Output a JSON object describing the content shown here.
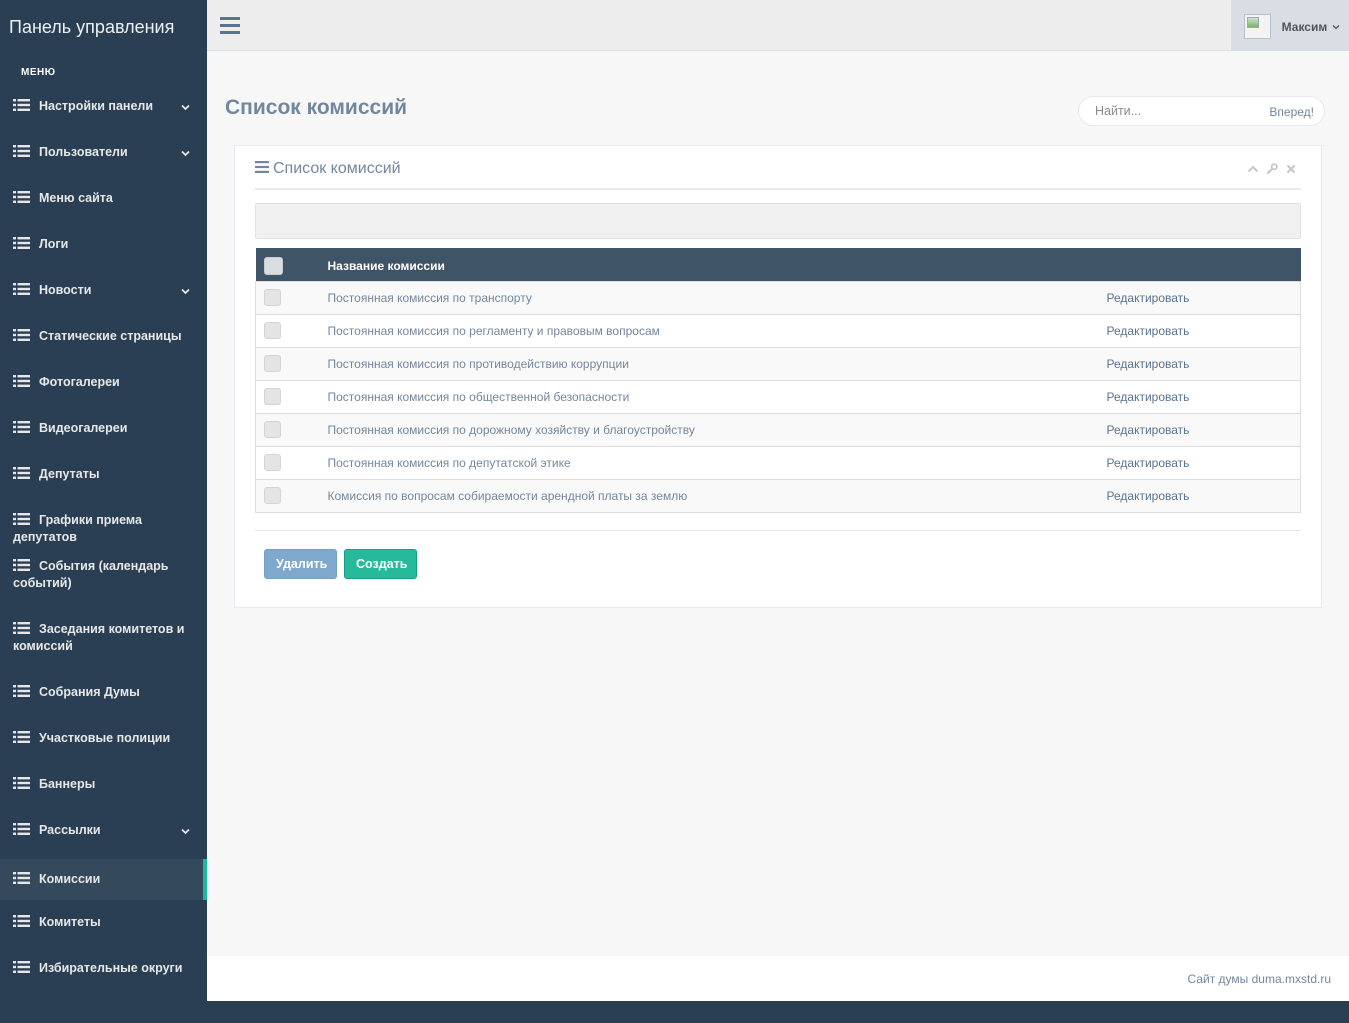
{
  "brand": {
    "title": "Панель управления"
  },
  "sidebar": {
    "heading": "меню",
    "items": [
      {
        "label": "Настройки панели",
        "has_submenu": true
      },
      {
        "label": "Пользователи",
        "has_submenu": true
      },
      {
        "label": "Меню сайта",
        "has_submenu": false
      },
      {
        "label": "Логи",
        "has_submenu": false
      },
      {
        "label": "Новости",
        "has_submenu": true
      },
      {
        "label": "Статические страницы",
        "has_submenu": false
      },
      {
        "label": "Фотогалереи",
        "has_submenu": false
      },
      {
        "label": "Видеогалереи",
        "has_submenu": false
      },
      {
        "label": "Депутаты",
        "has_submenu": false
      },
      {
        "label": "Графики приема депутатов",
        "has_submenu": false
      },
      {
        "label": "События (календарь событий)",
        "has_submenu": false
      },
      {
        "label": "Заседания комитетов и комиссий",
        "has_submenu": false
      },
      {
        "label": "Собрания Думы",
        "has_submenu": false
      },
      {
        "label": "Участковые полиции",
        "has_submenu": false
      },
      {
        "label": "Баннеры",
        "has_submenu": false
      },
      {
        "label": "Рассылки",
        "has_submenu": true
      },
      {
        "label": "Комиссии",
        "has_submenu": false,
        "active": true
      },
      {
        "label": "Комитеты",
        "has_submenu": false
      },
      {
        "label": "Избирательные округи",
        "has_submenu": false
      }
    ],
    "icons": {
      "item": "list-icon",
      "submenu": "chevron-down-icon"
    }
  },
  "topbar": {
    "toggle_icon": "hamburger-icon",
    "user": {
      "name": "Максим",
      "avatar": "broken-image-icon"
    }
  },
  "page": {
    "title": "Список комиссий",
    "search": {
      "placeholder": "Найти...",
      "value": "",
      "button": "Вперед!"
    }
  },
  "panel": {
    "title": "Список комиссий",
    "tools": [
      "collapse-icon",
      "wrench-icon",
      "close-icon"
    ],
    "table": {
      "columns": [
        "",
        "Название комиссии",
        ""
      ],
      "rows": [
        {
          "name": "Постоянная комиссия по транспорту",
          "action": "Редактировать"
        },
        {
          "name": "Постоянная комиссия по регламенту и правовым вопросам",
          "action": "Редактировать"
        },
        {
          "name": "Постоянная комиссия по противодействию коррупции",
          "action": "Редактировать"
        },
        {
          "name": "Постоянная комиссия по общественной безопасности",
          "action": "Редактировать"
        },
        {
          "name": "Постоянная комиссия по дорожному хозяйству и благоустройству",
          "action": "Редактировать"
        },
        {
          "name": "Постоянная комиссия по депутатской этике",
          "action": "Редактировать"
        },
        {
          "name": "Комиссия по вопросам собираемости арендной платы за землю",
          "action": "Редактировать"
        }
      ]
    },
    "buttons": {
      "delete": "Удалить",
      "create": "Создать"
    }
  },
  "footer": {
    "text": "Сайт думы duma.mxstd.ru"
  },
  "colors": {
    "sidebar_bg": "#2a3f54",
    "accent": "#1abb9c",
    "table_header": "#405467",
    "create_button": "#26b99a",
    "delete_button": "#7fa9cc"
  }
}
